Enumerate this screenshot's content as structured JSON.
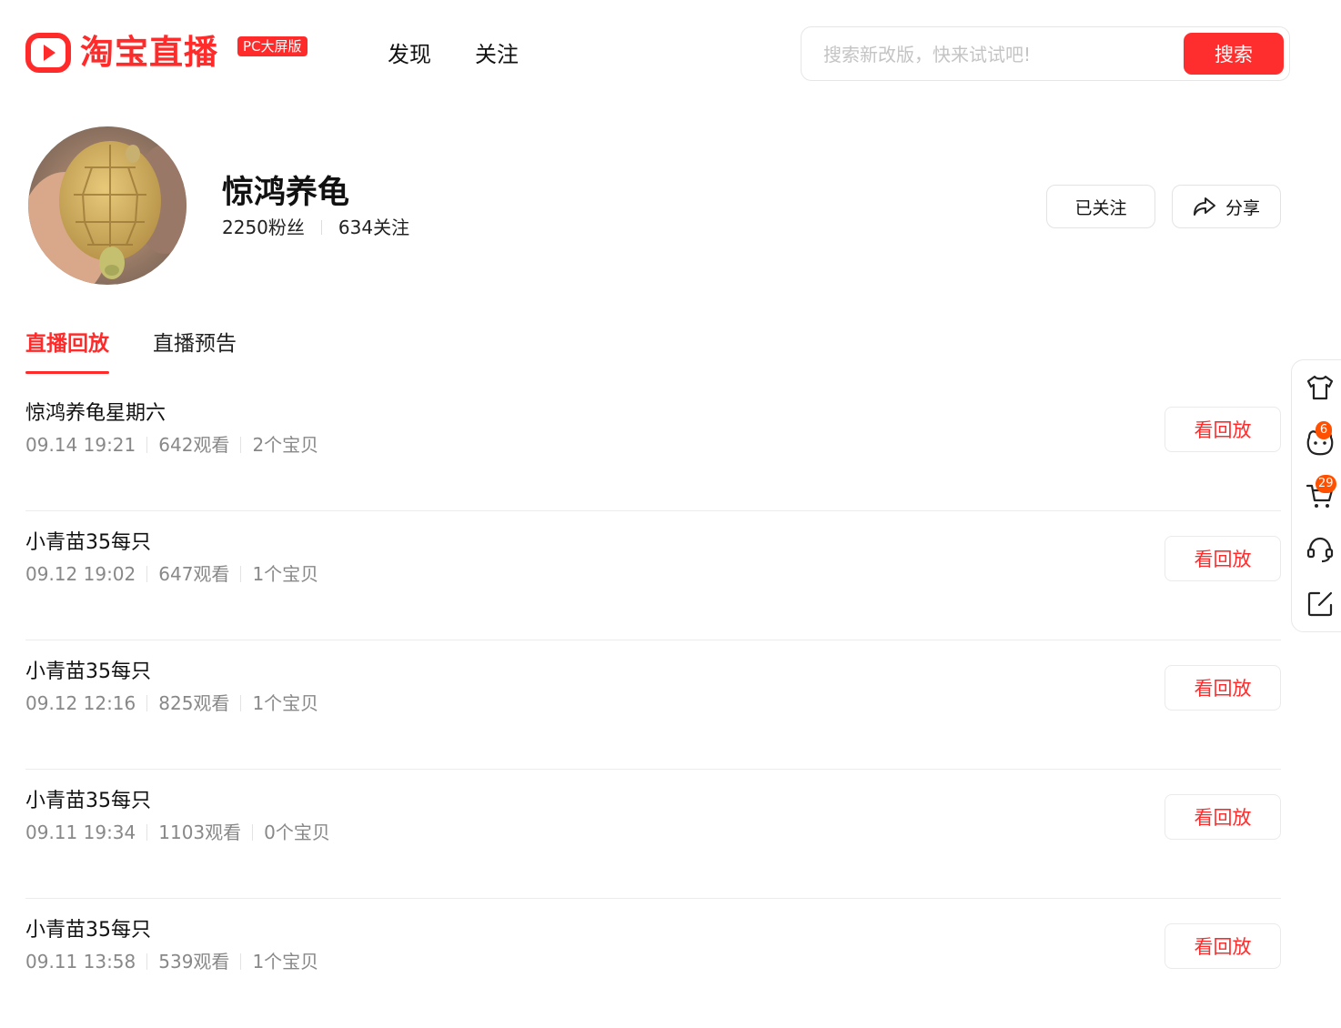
{
  "header": {
    "logo_text": "淘宝直播",
    "badge": "PC大屏版",
    "nav": [
      {
        "label": "发现"
      },
      {
        "label": "关注"
      }
    ],
    "search": {
      "placeholder": "搜索新改版，快来试试吧!",
      "button": "搜索"
    }
  },
  "profile": {
    "name": "惊鸿养龟",
    "fans": "2250粉丝",
    "following": "634关注",
    "follow_button": "已关注",
    "share_button": "分享"
  },
  "tabs": [
    {
      "label": "直播回放",
      "active": true
    },
    {
      "label": "直播预告",
      "active": false
    }
  ],
  "replays": [
    {
      "title": "惊鸿养龟星期六",
      "time": "09.14 19:21",
      "views": "642观看",
      "items": "2个宝贝",
      "button": "看回放"
    },
    {
      "title": "小青苗35每只",
      "time": "09.12 19:02",
      "views": "647观看",
      "items": "1个宝贝",
      "button": "看回放"
    },
    {
      "title": "小青苗35每只",
      "time": "09.12 12:16",
      "views": "825观看",
      "items": "1个宝贝",
      "button": "看回放"
    },
    {
      "title": "小青苗35每只",
      "time": "09.11 19:34",
      "views": "1103观看",
      "items": "0个宝贝",
      "button": "看回放"
    },
    {
      "title": "小青苗35每只",
      "time": "09.11 13:58",
      "views": "539观看",
      "items": "1个宝贝",
      "button": "看回放"
    }
  ],
  "sidebar": {
    "items": [
      {
        "icon": "shirt-icon"
      },
      {
        "icon": "face-icon",
        "badge": "6"
      },
      {
        "icon": "cart-icon",
        "badge": "29"
      },
      {
        "icon": "headset-icon"
      },
      {
        "icon": "edit-icon"
      }
    ]
  },
  "colors": {
    "brand": "#ff2b2b",
    "badge": "#ff5000"
  }
}
